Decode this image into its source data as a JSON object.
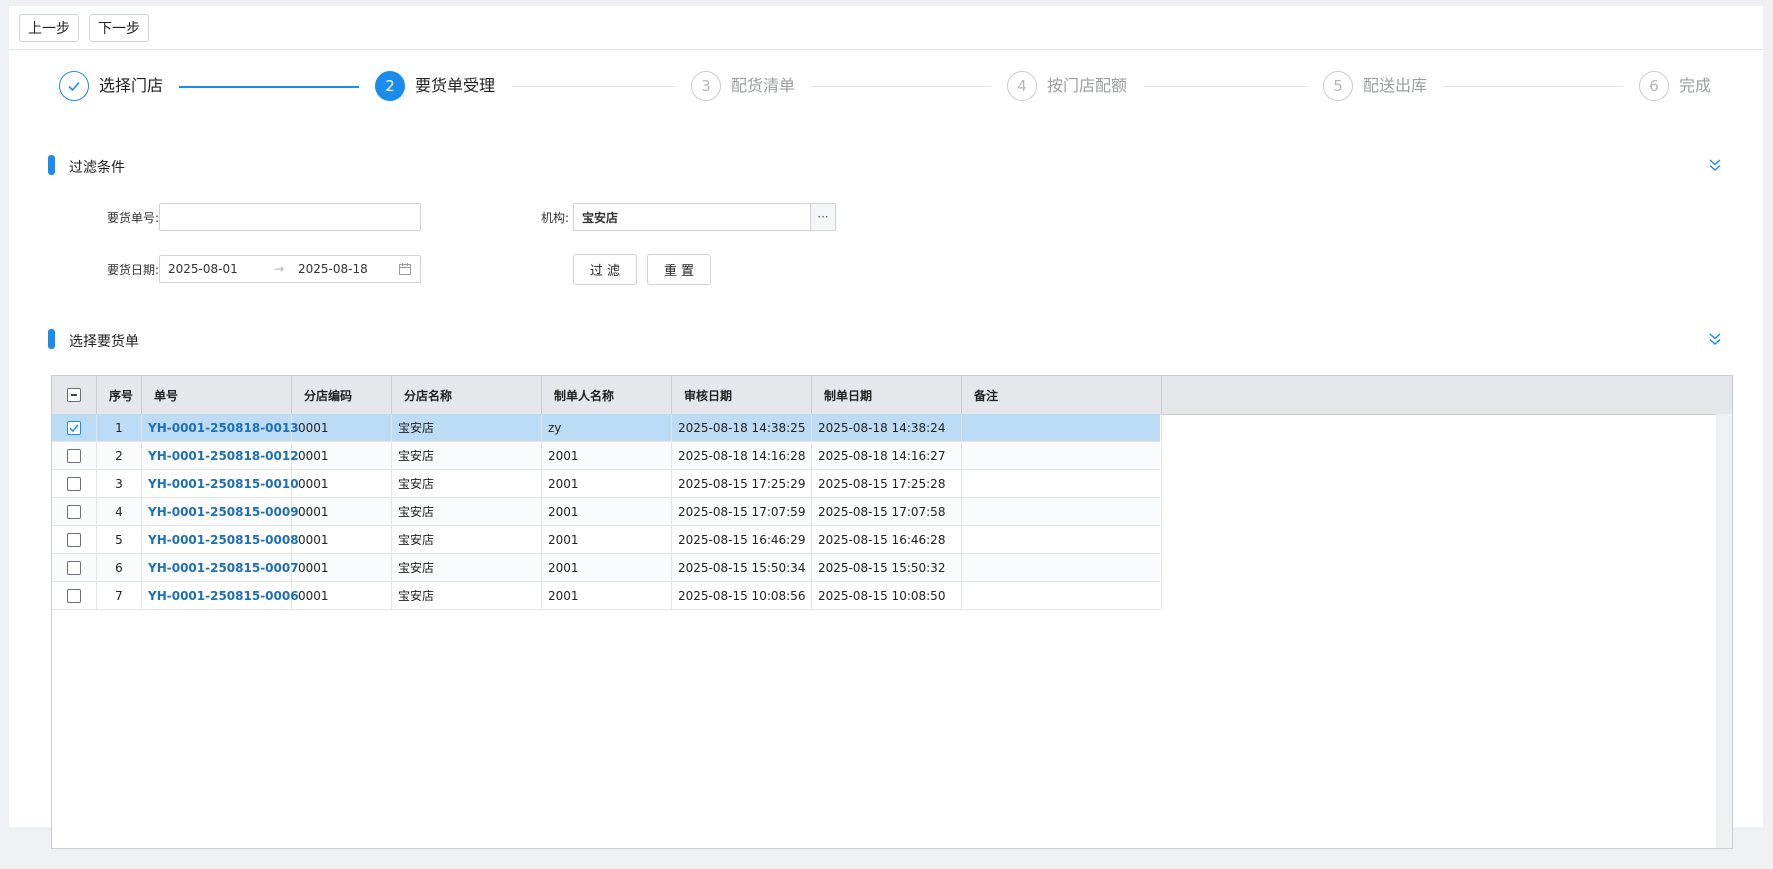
{
  "toolbar": {
    "prev_label": "上一步",
    "next_label": "下一步"
  },
  "steps": [
    {
      "number": "",
      "label": "选择门店",
      "state": "done"
    },
    {
      "number": "2",
      "label": "要货单受理",
      "state": "active"
    },
    {
      "number": "3",
      "label": "配货清单",
      "state": "todo"
    },
    {
      "number": "4",
      "label": "按门店配额",
      "state": "todo"
    },
    {
      "number": "5",
      "label": "配送出库",
      "state": "todo"
    },
    {
      "number": "6",
      "label": "完成",
      "state": "todo"
    }
  ],
  "filter": {
    "title": "过滤条件",
    "order_no_label": "要货单号:",
    "order_no_value": "",
    "org_label": "机构:",
    "org_value": "宝安店",
    "org_picker": "···",
    "date_label": "要货日期:",
    "date_start": "2025-08-01",
    "date_arrow": "→",
    "date_end": "2025-08-18",
    "filter_button": "过 滤",
    "reset_button": "重 置"
  },
  "orders_section": {
    "title": "选择要货单"
  },
  "table": {
    "columns": [
      "序号",
      "单号",
      "分店编码",
      "分店名称",
      "制单人名称",
      "审核日期",
      "制单日期",
      "备注"
    ],
    "rows": [
      {
        "seq": "1",
        "no": "YH-0001-250818-0013",
        "store_code": "0001",
        "store_name": "宝安店",
        "creator": "zy",
        "audit_date": "2025-08-18 14:38:25",
        "create_date": "2025-08-18 14:38:24",
        "remark": "",
        "checked": true
      },
      {
        "seq": "2",
        "no": "YH-0001-250818-0012",
        "store_code": "0001",
        "store_name": "宝安店",
        "creator": "2001",
        "audit_date": "2025-08-18 14:16:28",
        "create_date": "2025-08-18 14:16:27",
        "remark": "",
        "checked": false
      },
      {
        "seq": "3",
        "no": "YH-0001-250815-0010",
        "store_code": "0001",
        "store_name": "宝安店",
        "creator": "2001",
        "audit_date": "2025-08-15 17:25:29",
        "create_date": "2025-08-15 17:25:28",
        "remark": "",
        "checked": false
      },
      {
        "seq": "4",
        "no": "YH-0001-250815-0009",
        "store_code": "0001",
        "store_name": "宝安店",
        "creator": "2001",
        "audit_date": "2025-08-15 17:07:59",
        "create_date": "2025-08-15 17:07:58",
        "remark": "",
        "checked": false
      },
      {
        "seq": "5",
        "no": "YH-0001-250815-0008",
        "store_code": "0001",
        "store_name": "宝安店",
        "creator": "2001",
        "audit_date": "2025-08-15 16:46:29",
        "create_date": "2025-08-15 16:46:28",
        "remark": "",
        "checked": false
      },
      {
        "seq": "6",
        "no": "YH-0001-250815-0007",
        "store_code": "0001",
        "store_name": "宝安店",
        "creator": "2001",
        "audit_date": "2025-08-15 15:50:34",
        "create_date": "2025-08-15 15:50:32",
        "remark": "",
        "checked": false
      },
      {
        "seq": "7",
        "no": "YH-0001-250815-0006",
        "store_code": "0001",
        "store_name": "宝安店",
        "creator": "2001",
        "audit_date": "2025-08-15 10:08:56",
        "create_date": "2025-08-15 10:08:50",
        "remark": "",
        "checked": false
      }
    ]
  },
  "icons": {
    "step_done": "check-icon",
    "collapse": "double-chevron-down-icon",
    "calendar": "calendar-icon",
    "checkbox_header": "indeterminate-checkbox"
  },
  "colors": {
    "accent": "#1a8cee",
    "selected_row": "#bcdcf6",
    "link": "#1f6fb5"
  }
}
